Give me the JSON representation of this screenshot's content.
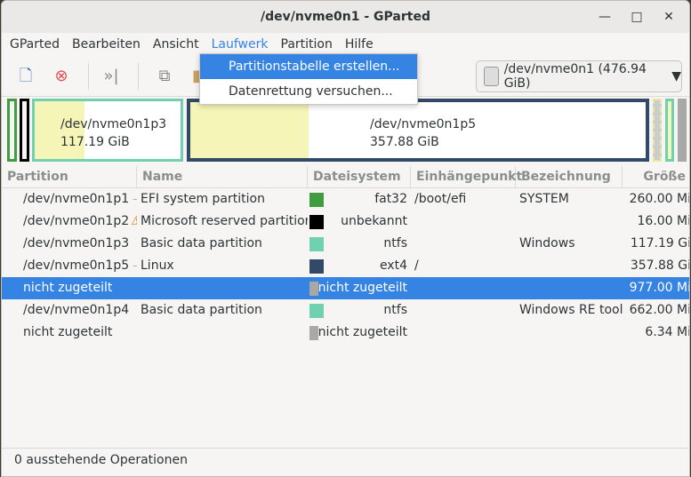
{
  "window": {
    "title": "/dev/nvme0n1 - GParted",
    "minimize": "—",
    "maximize": "□",
    "close": "✕"
  },
  "menubar": [
    "GParted",
    "Bearbeiten",
    "Ansicht",
    "Laufwerk",
    "Partition",
    "Hilfe"
  ],
  "dropdown": [
    "Partitionstabelle erstellen...",
    "Datenrettung versuchen..."
  ],
  "device_selector": "/dev/nvme0n1 (476.94 GiB)",
  "diskmap": [
    {
      "name": "/dev/nvme0n1p3",
      "size": "117.19 GiB"
    },
    {
      "name": "/dev/nvme0n1p5",
      "size": "357.88 GiB"
    }
  ],
  "columns": [
    "Partition",
    "Name",
    "Dateisystem",
    "Einhängepunkt",
    "Bezeichnung",
    "Größe"
  ],
  "rows": [
    {
      "partition": "/dev/nvme0n1p1",
      "icon": "key",
      "name": "EFI system partition",
      "fs": "fat32",
      "color": "#3f9c3f",
      "mount": "/boot/efi",
      "label": "SYSTEM",
      "size": "260.00 Mi"
    },
    {
      "partition": "/dev/nvme0n1p2",
      "icon": "warning",
      "name": "Microsoft reserved partition",
      "fs": "unbekannt",
      "color": "#000000",
      "mount": "",
      "label": "",
      "size": "16.00 Mi"
    },
    {
      "partition": "/dev/nvme0n1p3",
      "icon": "",
      "name": "Basic data partition",
      "fs": "ntfs",
      "color": "#70d0b0",
      "mount": "",
      "label": "Windows",
      "size": "117.19 Gi"
    },
    {
      "partition": "/dev/nvme0n1p5",
      "icon": "key",
      "name": "Linux",
      "fs": "ext4",
      "color": "#324a68",
      "mount": "/",
      "label": "",
      "size": "357.88 Gi"
    },
    {
      "partition": "nicht zugeteilt",
      "icon": "",
      "name": "",
      "fs": "nicht zugeteilt",
      "color": "#a8a8a8",
      "mount": "",
      "label": "",
      "size": "977.00 Mi"
    },
    {
      "partition": "/dev/nvme0n1p4",
      "icon": "",
      "name": "Basic data partition",
      "fs": "ntfs",
      "color": "#70d0b0",
      "mount": "",
      "label": "Windows RE tools",
      "size": "662.00 Mi"
    },
    {
      "partition": "nicht zugeteilt",
      "icon": "",
      "name": "",
      "fs": "nicht zugeteilt",
      "color": "#a8a8a8",
      "mount": "",
      "label": "",
      "size": "6.34 Mi"
    }
  ],
  "selected_row": 4,
  "status": "0 ausstehende Operationen"
}
